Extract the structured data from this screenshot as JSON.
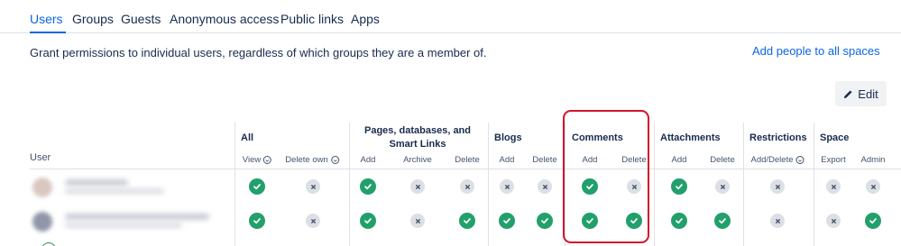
{
  "tabs": [
    "Users",
    "Groups",
    "Guests",
    "Anonymous access",
    "Public links",
    "Apps"
  ],
  "active_tab": "Users",
  "description": "Grant permissions to individual users, regardless of which groups they are a member of.",
  "add_people_link": "Add people to all spaces",
  "edit_button": "Edit",
  "table": {
    "user_header": "User",
    "groups": [
      "All",
      "Pages, databases, and Smart Links",
      "Blogs",
      "Comments",
      "Attachments",
      "Restrictions",
      "Space"
    ],
    "subheaders": [
      "View",
      "Delete own",
      "Add",
      "Archive",
      "Delete",
      "Add",
      "Delete",
      "Add",
      "Delete",
      "Add",
      "Delete",
      "Add/Delete",
      "Export",
      "Admin"
    ],
    "rows": [
      {
        "permissions": [
          true,
          false,
          true,
          false,
          false,
          false,
          false,
          true,
          false,
          true,
          false,
          false,
          false,
          false
        ]
      },
      {
        "permissions": [
          true,
          false,
          true,
          false,
          true,
          true,
          true,
          true,
          true,
          true,
          true,
          false,
          false,
          true
        ]
      }
    ]
  },
  "colors": {
    "accent": "#0c66e4",
    "granted": "#22a06b",
    "denied": "#dcdfe4",
    "highlight": "#d3132a"
  }
}
